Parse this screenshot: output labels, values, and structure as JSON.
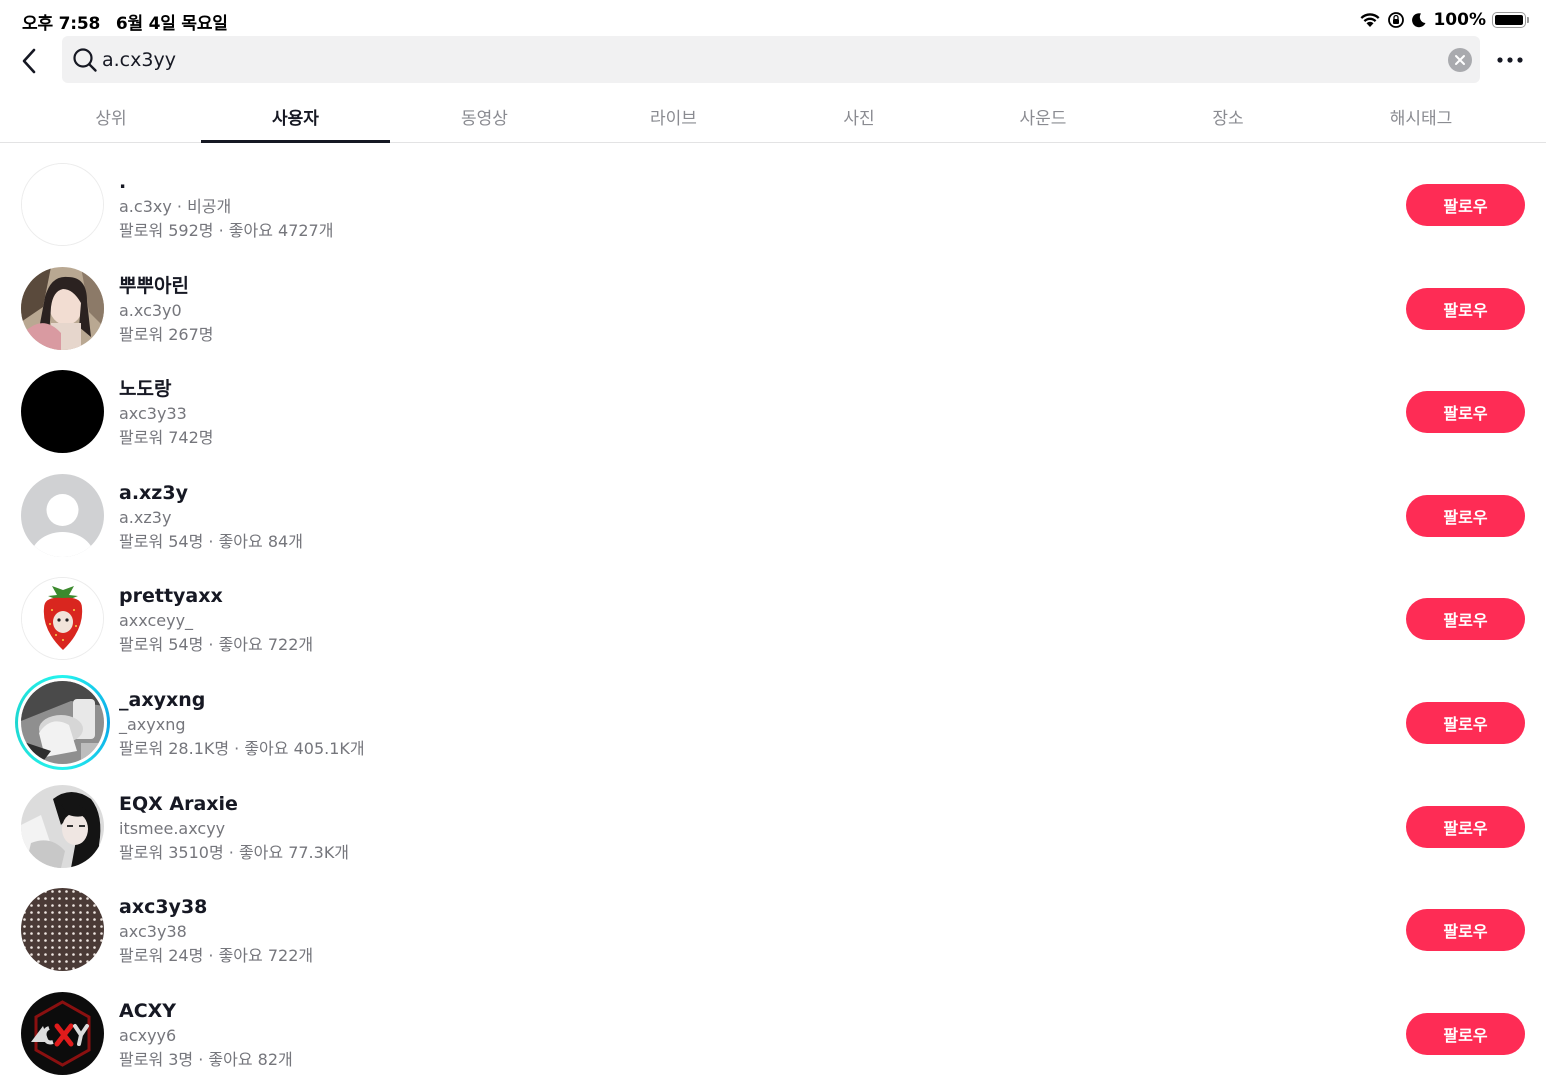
{
  "status_bar": {
    "time": "오후 7:58",
    "date": "6월 4일 목요일",
    "battery": "100%"
  },
  "search": {
    "query": "a.cx3yy"
  },
  "tabs": [
    {
      "label": "상위"
    },
    {
      "label": "사용자",
      "active": true
    },
    {
      "label": "동영상"
    },
    {
      "label": "라이브"
    },
    {
      "label": "사진"
    },
    {
      "label": "사운드"
    },
    {
      "label": "장소"
    },
    {
      "label": "해시태그"
    }
  ],
  "follow_label": "팔로우",
  "users": [
    {
      "display_name": ".",
      "username": "a.c3xy · 비공개",
      "stats": "팔로워 592명 · 좋아요 4727개",
      "avatar": "blank-avatar"
    },
    {
      "display_name": "뿌뿌아린",
      "username": "a.xc3y0",
      "stats": "팔로워 267명",
      "avatar": "photo-avatar"
    },
    {
      "display_name": "노도랑",
      "username": "axc3y33",
      "stats": "팔로워 742명",
      "avatar": "black-avatar"
    },
    {
      "display_name": "a.xz3y",
      "username": "a.xz3y",
      "stats": "팔로워 54명 · 좋아요 84개",
      "avatar": "default-person-avatar"
    },
    {
      "display_name": "prettyaxx",
      "username": "axxceyy_",
      "stats": "팔로워 54명 · 좋아요 722개",
      "avatar": "strawberry-avatar"
    },
    {
      "display_name": "_axyxng",
      "username": "_axyxng",
      "stats": "팔로워 28.1K명 · 좋아요 405.1K개",
      "avatar": "photo-avatar-story"
    },
    {
      "display_name": "EQX Araxie",
      "username": "itsmee.axcyy",
      "stats": "팔로워 3510명 · 좋아요 77.3K개",
      "avatar": "anime-avatar"
    },
    {
      "display_name": "axc3y38",
      "username": "axc3y38",
      "stats": "팔로워 24명 · 좋아요 722개",
      "avatar": "polka-dot-avatar"
    },
    {
      "display_name": "ACXY",
      "username": "acxyy6",
      "stats": "팔로워 3명 · 좋아요 82개",
      "avatar": "acxy-logo-avatar"
    }
  ]
}
